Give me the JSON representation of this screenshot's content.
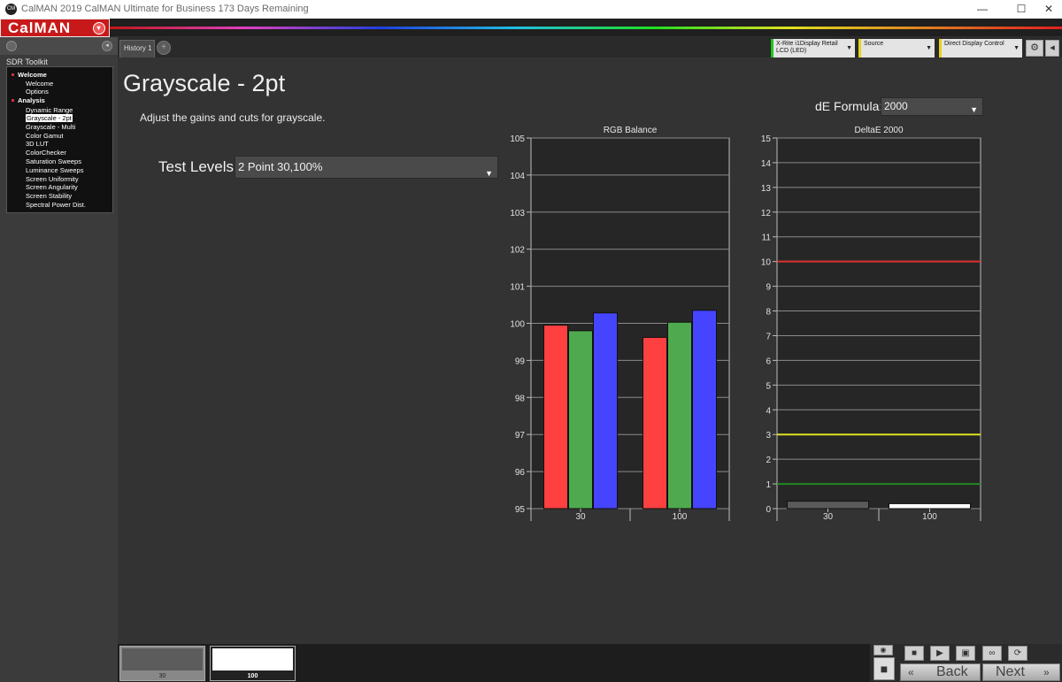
{
  "window": {
    "title": "CalMAN 2019 CalMAN Ultimate for Business 173 Days Remaining",
    "app_icon": "CM",
    "minimize_icon": "—",
    "maximize_icon": "☐",
    "close_icon": "✕"
  },
  "logo": {
    "text": "CalMAN",
    "drop_icon": "▾"
  },
  "sidebar": {
    "title": "SDR Toolkit",
    "groups": [
      {
        "label": "Welcome",
        "items": [
          "Welcome",
          "Options"
        ]
      },
      {
        "label": "Analysis",
        "items": [
          "Dynamic Range",
          "Grayscale - 2pt",
          "Grayscale - Multi",
          "Color Gamut",
          "3D LUT",
          "ColorChecker",
          "Saturation Sweeps",
          "Luminance Sweeps",
          "Screen Uniformity",
          "Screen Angularity",
          "Screen Stability",
          "Spectral Power Dist."
        ]
      }
    ],
    "selected": "Grayscale - 2pt"
  },
  "tabs": {
    "history": "History 1",
    "add": "+"
  },
  "devices": {
    "meter": {
      "line1": "X-Rite i1Display Retail",
      "line2": "LCD (LED)",
      "accent": "#22c322"
    },
    "source": {
      "line1": "Source",
      "accent": "#e6d31c"
    },
    "display": {
      "line1": "Direct Display Control",
      "accent": "#e6d31c"
    },
    "dropdown_icon": "▼",
    "settings_icon": "⚙",
    "collapse_icon": "◂"
  },
  "main": {
    "title": "Grayscale - 2pt",
    "instructions": "Adjust the gains and cuts for grayscale.",
    "test_levels_label": "Test Levels:",
    "test_levels_value": "2 Point 30,100%",
    "de_formula_label": "dE Formula:",
    "de_formula_value": "2000",
    "dropdown_icon": "▼"
  },
  "chart_data": [
    {
      "type": "bar",
      "title": "RGB Balance",
      "categories": [
        "30",
        "100"
      ],
      "series": [
        {
          "color": "#ff4040",
          "values": [
            99.95,
            99.62
          ]
        },
        {
          "color": "#4faa4f",
          "values": [
            99.8,
            100.03
          ]
        },
        {
          "color": "#4545ff",
          "values": [
            100.28,
            100.35
          ]
        }
      ],
      "ylim": [
        95,
        105
      ],
      "yticks": [
        95,
        96,
        97,
        98,
        99,
        100,
        101,
        102,
        103,
        104,
        105
      ],
      "reference_line": 100
    },
    {
      "type": "bar",
      "title": "DeltaE 2000",
      "categories": [
        "30",
        "100"
      ],
      "values": [
        0.3,
        0.2
      ],
      "bar_colors": [
        "#5a5a5a",
        "#ffffff"
      ],
      "ylim": [
        0,
        15
      ],
      "yticks": [
        0,
        1,
        2,
        3,
        4,
        5,
        6,
        7,
        8,
        9,
        10,
        11,
        12,
        13,
        14,
        15
      ],
      "threshold_lines": [
        {
          "value": 10,
          "color": "#e03030"
        },
        {
          "value": 3,
          "color": "#e0e020"
        },
        {
          "value": 1,
          "color": "#228822"
        }
      ]
    }
  ],
  "bottom": {
    "swatches": [
      {
        "label": "30",
        "color": "#5c5c5c"
      },
      {
        "label": "100",
        "color": "#ffffff"
      }
    ],
    "controls": {
      "eye_icon": "◉",
      "stop_icon": "■",
      "small_stop_icon": "■",
      "play_icon": "▶",
      "save_icon": "▣",
      "loop_icon": "∞",
      "refresh_icon": "⟳",
      "back_label": "Back",
      "back_icon": "«",
      "next_label": "Next",
      "next_icon": "»"
    }
  }
}
